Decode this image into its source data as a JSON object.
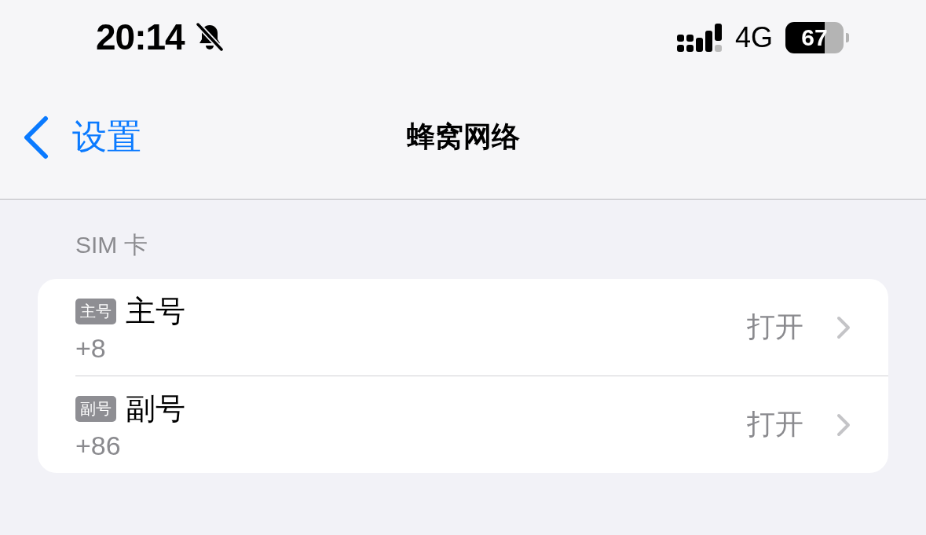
{
  "status_bar": {
    "time": "20:14",
    "silent": true,
    "network": "4G",
    "battery": "67"
  },
  "nav_bar": {
    "back": "设置",
    "title": "蜂窝网络"
  },
  "section": {
    "header": "SIM 卡",
    "rows": [
      {
        "badge": "主号",
        "title": "主号",
        "subtitle": "+8",
        "value": "打开"
      },
      {
        "badge": "副号",
        "title": "副号",
        "subtitle": "+86",
        "value": "打开"
      }
    ]
  }
}
